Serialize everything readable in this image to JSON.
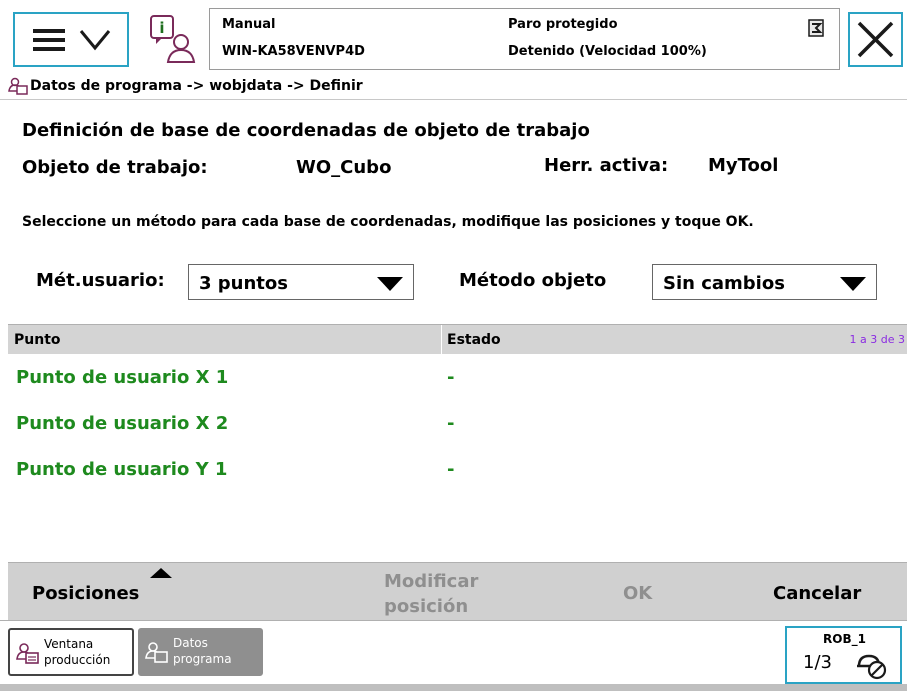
{
  "topbar": {
    "menu_icon": "hamburger-chevron-icon",
    "info_icon": "operator-info-icon",
    "mode": "Manual",
    "host": "WIN-KA58VENVP4D",
    "state": "Paro protegido",
    "motion": "Detenido (Velocidad 100%)",
    "speed_icon": "speed-status-icon",
    "close_icon": "close-icon"
  },
  "breadcrumb": {
    "icon": "program-data-icon",
    "path": "Datos de programa -> wobjdata -> Definir"
  },
  "header": {
    "title": "Definición de base de coordenadas de objeto de trabajo",
    "workobject_label": "Objeto de trabajo:",
    "workobject_value": "WO_Cubo",
    "tool_label": "Herr. activa:",
    "tool_value": "MyTool",
    "instructions": "Seleccione un método para cada base de coordenadas, modifique las posiciones y toque OK."
  },
  "methods": {
    "user_label": "Mét.usuario:",
    "user_value": "3 puntos",
    "object_label": "Método objeto",
    "object_value": "Sin cambios"
  },
  "table": {
    "columns": [
      "Punto",
      "Estado"
    ],
    "count": "1 a 3 de 3",
    "rows": [
      {
        "point": "Punto de usuario X 1",
        "state": "-"
      },
      {
        "point": "Punto de usuario X 2",
        "state": "-"
      },
      {
        "point": "Punto de usuario Y 1",
        "state": "-"
      }
    ]
  },
  "commands": {
    "positions": "Posiciones",
    "modify_line1": "Modificar",
    "modify_line2": "posición",
    "ok": "OK",
    "cancel": "Cancelar"
  },
  "taskbar": {
    "production_line1": "Ventana",
    "production_line2": "producción",
    "data_line1": "Datos",
    "data_line2": "programa",
    "robot": "ROB_1",
    "increment": "1/3"
  },
  "colors": {
    "accent": "#2aa3c4",
    "ok_text": "#1e8a1e",
    "disabled": "#8f8f8f",
    "count_text": "#8a2be2"
  }
}
